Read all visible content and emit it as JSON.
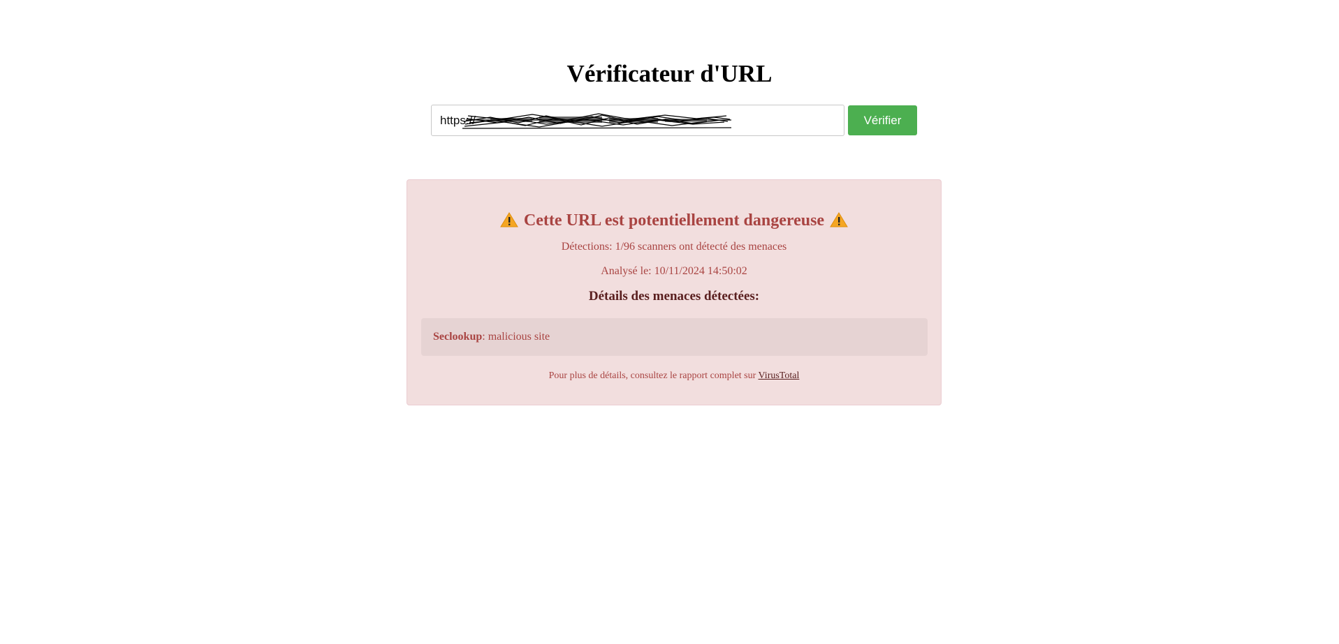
{
  "header": {
    "title": "Vérificateur d'URL"
  },
  "search": {
    "value": "https://",
    "button_label": "Vérifier"
  },
  "result": {
    "heading": "Cette URL est potentiellement dangereuse",
    "warning_icon": "warning-triangle",
    "detections_text": "Détections: 1/96 scanners ont détecté des menaces",
    "analyzed_text": "Analysé le: 10/11/2024 14:50:02",
    "details_heading": "Détails des menaces détectées:",
    "threats": [
      {
        "engine": "Seclookup",
        "verdict": ": malicious site"
      }
    ],
    "footer_text": "Pour plus de détails, consultez le rapport complet sur ",
    "footer_link": "VirusTotal"
  },
  "colors": {
    "danger_bg": "#f2dede",
    "danger_text": "#a94442",
    "button_green": "#4caf50",
    "warning_orange": "#f5a623"
  }
}
